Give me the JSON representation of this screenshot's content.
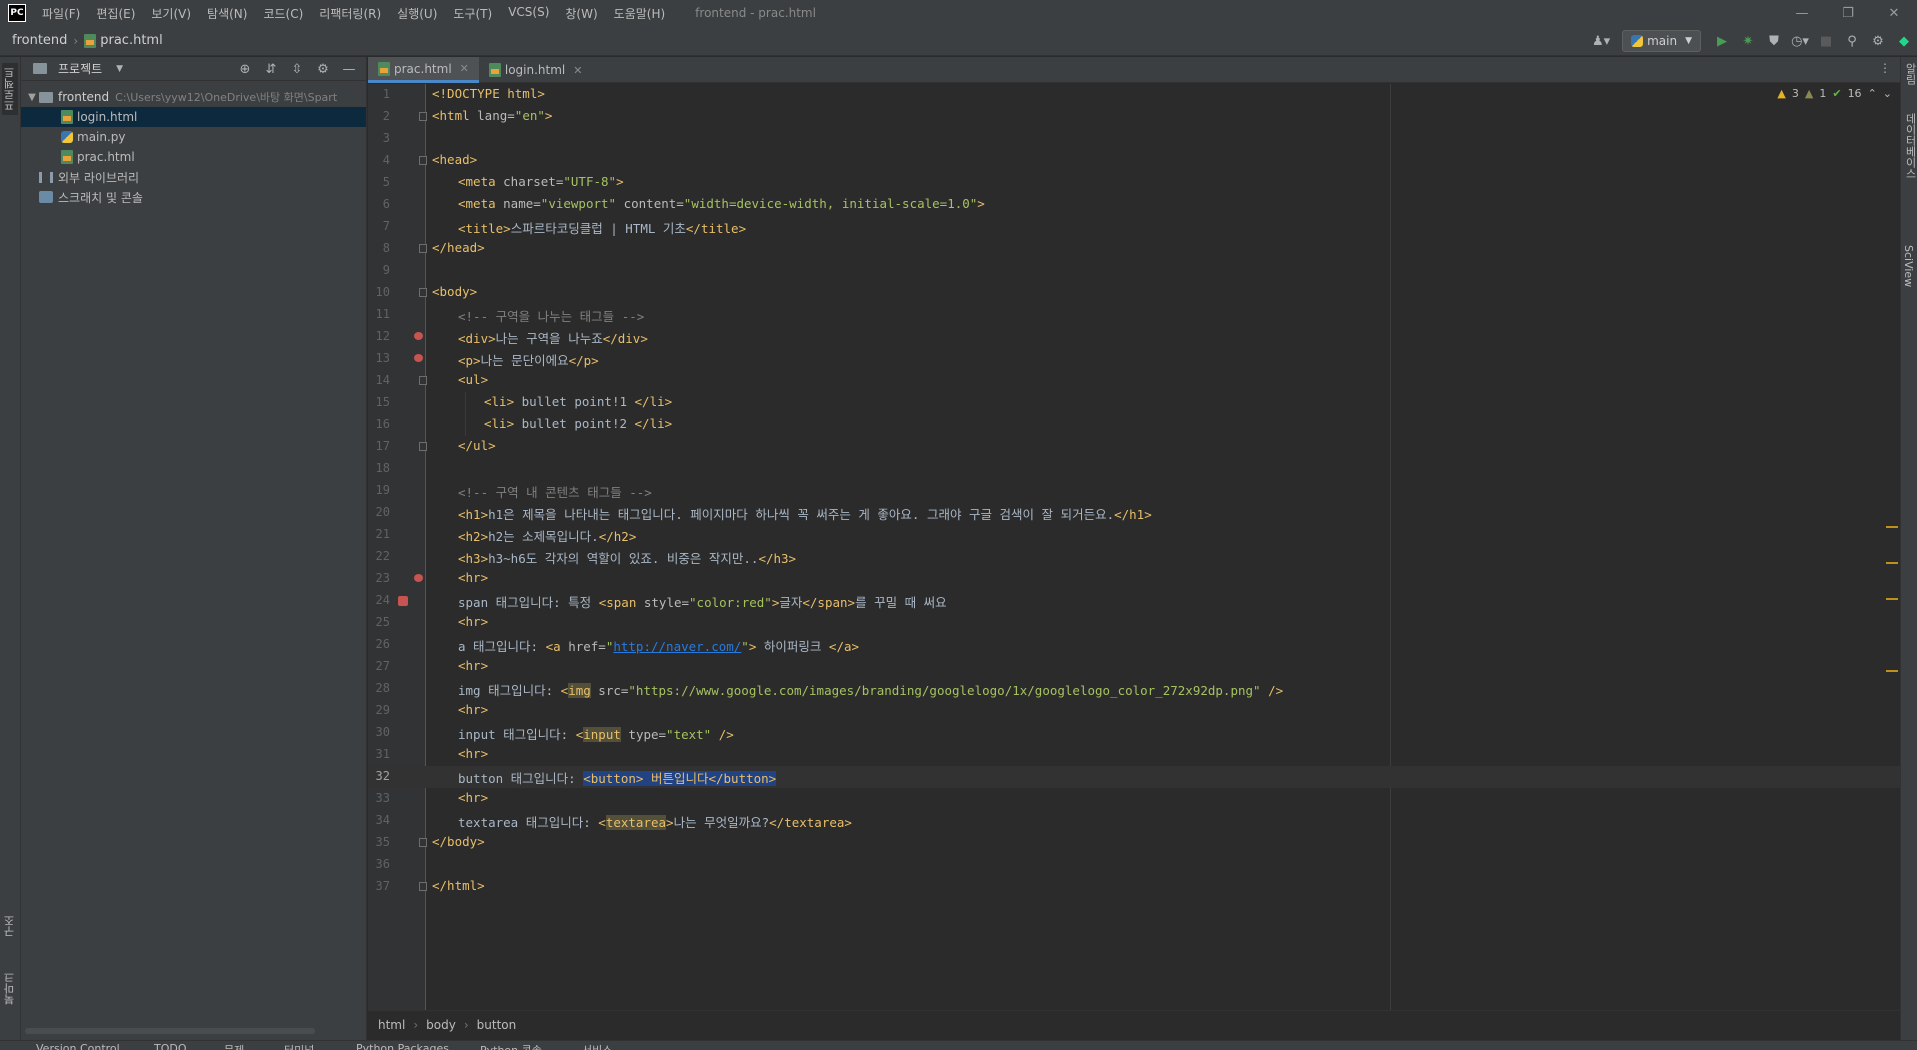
{
  "menubar": {
    "logo": "PC",
    "items": [
      "파일(F)",
      "편집(E)",
      "보기(V)",
      "탐색(N)",
      "코드(C)",
      "리팩터링(R)",
      "실행(U)",
      "도구(T)",
      "VCS(S)",
      "창(W)",
      "도움말(H)"
    ],
    "window_title": "frontend - prac.html"
  },
  "navbar": {
    "project": "frontend",
    "file": "prac.html",
    "branch": "main"
  },
  "left_strip": {
    "top_tab": "프로젝트",
    "bottom_tabs": [
      "구조",
      "북마크"
    ]
  },
  "project_panel": {
    "title": "프로젝트",
    "root": {
      "name": "frontend",
      "path": "C:\\Users\\yyw12\\OneDrive\\바탕 화면\\Spart"
    },
    "files": [
      "login.html",
      "main.py",
      "prac.html"
    ],
    "selected_file": "login.html",
    "external": "외부 라이브러리",
    "scratches": "스크래치 및 콘솔"
  },
  "editor_tabs": [
    {
      "label": "prac.html",
      "active": true
    },
    {
      "label": "login.html",
      "active": false
    }
  ],
  "inspection": {
    "warnings": "3",
    "weak_warnings": "1",
    "ok": "16"
  },
  "code_lines": [
    {
      "n": "1",
      "indent": 0,
      "parts": [
        [
          "doctype",
          "<!DOCTYPE html>"
        ]
      ]
    },
    {
      "n": "2",
      "indent": 0,
      "parts": [
        [
          "tag",
          "<html "
        ],
        [
          "attr",
          "lang="
        ],
        [
          "str",
          "\"en\""
        ],
        [
          "tag",
          ">"
        ]
      ]
    },
    {
      "n": "3",
      "indent": 0,
      "parts": []
    },
    {
      "n": "4",
      "indent": 0,
      "parts": [
        [
          "tag",
          "<head>"
        ]
      ]
    },
    {
      "n": "5",
      "indent": 1,
      "parts": [
        [
          "tag",
          "<meta "
        ],
        [
          "attr",
          "charset="
        ],
        [
          "str",
          "\"UTF-8\""
        ],
        [
          "tag",
          ">"
        ]
      ]
    },
    {
      "n": "6",
      "indent": 1,
      "parts": [
        [
          "tag",
          "<meta "
        ],
        [
          "attr",
          "name="
        ],
        [
          "str",
          "\"viewport\""
        ],
        [
          "attr",
          " content="
        ],
        [
          "str",
          "\"width=device-width, initial-scale=1.0\""
        ],
        [
          "tag",
          ">"
        ]
      ]
    },
    {
      "n": "7",
      "indent": 1,
      "parts": [
        [
          "tag",
          "<title>"
        ],
        [
          "txt",
          "스파르타코딩클럽 | HTML 기초"
        ],
        [
          "tag",
          "</title>"
        ]
      ]
    },
    {
      "n": "8",
      "indent": 0,
      "parts": [
        [
          "tag",
          "</head>"
        ]
      ]
    },
    {
      "n": "9",
      "indent": 0,
      "parts": []
    },
    {
      "n": "10",
      "indent": 0,
      "parts": [
        [
          "tag",
          "<body>"
        ]
      ]
    },
    {
      "n": "11",
      "indent": 1,
      "parts": [
        [
          "cm",
          "<!-- 구역을 나누는 태그들 -->"
        ]
      ]
    },
    {
      "n": "12",
      "indent": 1,
      "parts": [
        [
          "tag",
          "<div>"
        ],
        [
          "txt",
          "나는 구역을 나누죠"
        ],
        [
          "tag",
          "</div>"
        ]
      ]
    },
    {
      "n": "13",
      "indent": 1,
      "parts": [
        [
          "tag",
          "<p>"
        ],
        [
          "txt",
          "나는 문단이에요"
        ],
        [
          "tag",
          "</p>"
        ]
      ]
    },
    {
      "n": "14",
      "indent": 1,
      "parts": [
        [
          "tag",
          "<ul>"
        ]
      ]
    },
    {
      "n": "15",
      "indent": 2,
      "parts": [
        [
          "tag",
          "<li>"
        ],
        [
          "txt",
          " bullet point!1 "
        ],
        [
          "tag",
          "</li>"
        ]
      ]
    },
    {
      "n": "16",
      "indent": 2,
      "parts": [
        [
          "tag",
          "<li>"
        ],
        [
          "txt",
          " bullet point!2 "
        ],
        [
          "tag",
          "</li>"
        ]
      ]
    },
    {
      "n": "17",
      "indent": 1,
      "parts": [
        [
          "tag",
          "</ul>"
        ]
      ]
    },
    {
      "n": "18",
      "indent": 0,
      "parts": []
    },
    {
      "n": "19",
      "indent": 1,
      "parts": [
        [
          "cm",
          "<!-- 구역 내 콘텐츠 태그들 -->"
        ]
      ]
    },
    {
      "n": "20",
      "indent": 1,
      "parts": [
        [
          "tag",
          "<h1>"
        ],
        [
          "txt",
          "h1은 제목을 나타내는 태그입니다. 페이지마다 하나씩 꼭 써주는 게 좋아요. 그래야 구글 검색이 잘 되거든요."
        ],
        [
          "tag",
          "</h1>"
        ]
      ]
    },
    {
      "n": "21",
      "indent": 1,
      "parts": [
        [
          "tag",
          "<h2>"
        ],
        [
          "txt",
          "h2는 소제목입니다."
        ],
        [
          "tag",
          "</h2>"
        ]
      ]
    },
    {
      "n": "22",
      "indent": 1,
      "parts": [
        [
          "tag",
          "<h3>"
        ],
        [
          "txt",
          "h3~h6도 각자의 역할이 있죠. 비중은 작지만.."
        ],
        [
          "tag",
          "</h3>"
        ]
      ]
    },
    {
      "n": "23",
      "indent": 1,
      "parts": [
        [
          "tag",
          "<hr>"
        ]
      ]
    },
    {
      "n": "24",
      "indent": 1,
      "parts": [
        [
          "txt",
          "span 태그입니다: 특정 "
        ],
        [
          "tag",
          "<span "
        ],
        [
          "attr",
          "style="
        ],
        [
          "str",
          "\"color:red\""
        ],
        [
          "tag",
          ">"
        ],
        [
          "txt",
          "글자"
        ],
        [
          "tag",
          "</span>"
        ],
        [
          "txt",
          "를 꾸밀 때 써요"
        ]
      ]
    },
    {
      "n": "25",
      "indent": 1,
      "parts": [
        [
          "tag",
          "<hr>"
        ]
      ]
    },
    {
      "n": "26",
      "indent": 1,
      "parts": [
        [
          "txt",
          "a 태그입니다: "
        ],
        [
          "tag",
          "<a "
        ],
        [
          "attr",
          "href="
        ],
        [
          "str",
          "\""
        ],
        [
          "url",
          "http://naver.com/"
        ],
        [
          "str",
          "\""
        ],
        [
          "tag",
          ">"
        ],
        [
          "txt",
          " 하이퍼링크 "
        ],
        [
          "tag",
          "</a>"
        ]
      ]
    },
    {
      "n": "27",
      "indent": 1,
      "parts": [
        [
          "tag",
          "<hr>"
        ]
      ]
    },
    {
      "n": "28",
      "indent": 1,
      "parts": [
        [
          "txt",
          "img 태그입니다: "
        ],
        [
          "tag",
          "<"
        ],
        [
          "warn",
          "img"
        ],
        [
          "attr",
          " src="
        ],
        [
          "str",
          "\"https://www.google.com/images/branding/googlelogo/1x/googlelogo_color_272x92dp.png\""
        ],
        [
          "tag",
          " />"
        ]
      ]
    },
    {
      "n": "29",
      "indent": 1,
      "parts": [
        [
          "tag",
          "<hr>"
        ]
      ]
    },
    {
      "n": "30",
      "indent": 1,
      "parts": [
        [
          "txt",
          "input 태그입니다: "
        ],
        [
          "tag",
          "<"
        ],
        [
          "warn",
          "input"
        ],
        [
          "attr",
          " type="
        ],
        [
          "str",
          "\"text\""
        ],
        [
          "tag",
          " />"
        ]
      ]
    },
    {
      "n": "31",
      "indent": 1,
      "parts": [
        [
          "tag",
          "<hr>"
        ]
      ]
    },
    {
      "n": "32",
      "indent": 1,
      "parts": [
        [
          "txt",
          "button 태그입니다: "
        ],
        [
          "sel",
          "<button> 버튼입니다</button>"
        ]
      ]
    },
    {
      "n": "33",
      "indent": 1,
      "parts": [
        [
          "tag",
          "<hr>"
        ]
      ]
    },
    {
      "n": "34",
      "indent": 1,
      "parts": [
        [
          "txt",
          "textarea 태그입니다: "
        ],
        [
          "tag",
          "<"
        ],
        [
          "warn",
          "textarea"
        ],
        [
          "tag",
          ">"
        ],
        [
          "txt",
          "나는 무엇일까요?"
        ],
        [
          "tag",
          "</textarea>"
        ]
      ]
    },
    {
      "n": "35",
      "indent": 0,
      "parts": [
        [
          "tag",
          "</body>"
        ]
      ]
    },
    {
      "n": "36",
      "indent": 0,
      "parts": []
    },
    {
      "n": "37",
      "indent": 0,
      "parts": [
        [
          "tag",
          "</html>"
        ]
      ]
    }
  ],
  "current_line": "32",
  "editor_breadcrumb": [
    "html",
    "body",
    "button"
  ],
  "right_strip": [
    "알림",
    "데이터베이스",
    "SciView"
  ],
  "bottom_tools": [
    "Version Control",
    "TODO",
    "문제",
    "터미널",
    "Python Packages",
    "Python 콘솔",
    "서비스"
  ]
}
